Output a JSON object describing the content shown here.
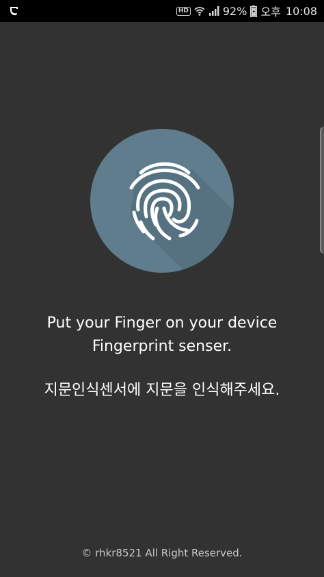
{
  "status_bar": {
    "hd_label": "HD",
    "battery_percent": "92%",
    "ampm": "오후",
    "time": "10:08",
    "icons": [
      "app-logo-icon",
      "hd-icon",
      "wifi-icon",
      "signal-icon",
      "battery-icon"
    ]
  },
  "fingerprint": {
    "icon": "fingerprint-icon",
    "circle_color": "#5f7d8c"
  },
  "message": {
    "line1": "Put your Finger on your device",
    "line2": "Fingerprint senser.",
    "korean": "지문인식센서에 지문을 인식해주세요."
  },
  "footer": {
    "copyright": "© rhkr8521 All Right Reserved."
  },
  "colors": {
    "background": "#323232",
    "status_bar": "#000000",
    "text": "#ffffff"
  }
}
